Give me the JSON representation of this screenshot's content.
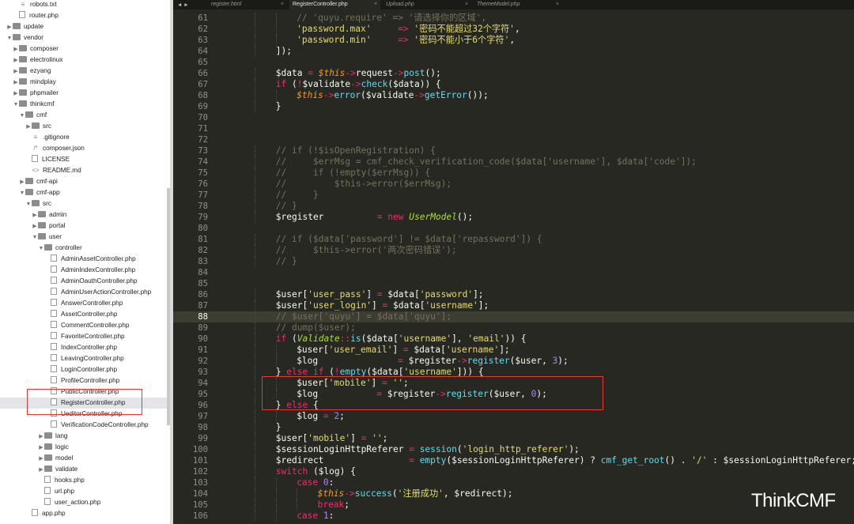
{
  "tabs": [
    {
      "label": "register.html",
      "active": false
    },
    {
      "label": "RegisterController.php",
      "active": true
    },
    {
      "label": "Upload.php",
      "active": false
    },
    {
      "label": "ThemeModel.php",
      "active": false
    }
  ],
  "tree": [
    {
      "label": "robots.txt",
      "depth": 2,
      "type": "txt"
    },
    {
      "label": "router.php",
      "depth": 2,
      "type": "file"
    },
    {
      "label": "update",
      "depth": 0,
      "type": "folder",
      "arrow": "right"
    },
    {
      "label": "vendor",
      "depth": 0,
      "type": "folder",
      "arrow": "down"
    },
    {
      "label": "composer",
      "depth": 1,
      "type": "folder",
      "arrow": "right"
    },
    {
      "label": "electrolinux",
      "depth": 1,
      "type": "folder",
      "arrow": "right"
    },
    {
      "label": "ezyang",
      "depth": 1,
      "type": "folder",
      "arrow": "right"
    },
    {
      "label": "mindplay",
      "depth": 1,
      "type": "folder",
      "arrow": "right"
    },
    {
      "label": "phpmailer",
      "depth": 1,
      "type": "folder",
      "arrow": "right"
    },
    {
      "label": "thinkcmf",
      "depth": 1,
      "type": "folder",
      "arrow": "down"
    },
    {
      "label": "cmf",
      "depth": 2,
      "type": "folder",
      "arrow": "down"
    },
    {
      "label": "src",
      "depth": 3,
      "type": "folder",
      "arrow": "right"
    },
    {
      "label": ".gitignore",
      "depth": 4,
      "type": "txt"
    },
    {
      "label": "composer.json",
      "depth": 4,
      "type": "json"
    },
    {
      "label": "LICENSE",
      "depth": 4,
      "type": "file"
    },
    {
      "label": "README.md",
      "depth": 4,
      "type": "md"
    },
    {
      "label": "cmf-api",
      "depth": 2,
      "type": "folder",
      "arrow": "right"
    },
    {
      "label": "cmf-app",
      "depth": 2,
      "type": "folder",
      "arrow": "down"
    },
    {
      "label": "src",
      "depth": 3,
      "type": "folder",
      "arrow": "down"
    },
    {
      "label": "admin",
      "depth": 4,
      "type": "folder",
      "arrow": "right"
    },
    {
      "label": "portal",
      "depth": 4,
      "type": "folder",
      "arrow": "right"
    },
    {
      "label": "user",
      "depth": 4,
      "type": "folder",
      "arrow": "down"
    },
    {
      "label": "controller",
      "depth": 5,
      "type": "folder",
      "arrow": "down"
    },
    {
      "label": "AdminAssetController.php",
      "depth": 7,
      "type": "file"
    },
    {
      "label": "AdminIndexController.php",
      "depth": 7,
      "type": "file"
    },
    {
      "label": "AdminOauthController.php",
      "depth": 7,
      "type": "file"
    },
    {
      "label": "AdminUserActionController.php",
      "depth": 7,
      "type": "file"
    },
    {
      "label": "AnswerController.php",
      "depth": 7,
      "type": "file"
    },
    {
      "label": "AssetController.php",
      "depth": 7,
      "type": "file"
    },
    {
      "label": "CommentController.php",
      "depth": 7,
      "type": "file"
    },
    {
      "label": "FavoriteController.php",
      "depth": 7,
      "type": "file"
    },
    {
      "label": "IndexController.php",
      "depth": 7,
      "type": "file"
    },
    {
      "label": "LeavingController.php",
      "depth": 7,
      "type": "file"
    },
    {
      "label": "LoginController.php",
      "depth": 7,
      "type": "file"
    },
    {
      "label": "ProfileController.php",
      "depth": 7,
      "type": "file"
    },
    {
      "label": "PublicController.php",
      "depth": 7,
      "type": "file"
    },
    {
      "label": "RegisterController.php",
      "depth": 7,
      "type": "file",
      "selected": true
    },
    {
      "label": "UeditorController.php",
      "depth": 7,
      "type": "file"
    },
    {
      "label": "VerificationCodeController.php",
      "depth": 7,
      "type": "file"
    },
    {
      "label": "lang",
      "depth": 5,
      "type": "folder",
      "arrow": "right"
    },
    {
      "label": "logic",
      "depth": 5,
      "type": "folder",
      "arrow": "right"
    },
    {
      "label": "model",
      "depth": 5,
      "type": "folder",
      "arrow": "right"
    },
    {
      "label": "validate",
      "depth": 5,
      "type": "folder",
      "arrow": "right"
    },
    {
      "label": "hooks.php",
      "depth": 6,
      "type": "file"
    },
    {
      "label": "url.php",
      "depth": 6,
      "type": "file"
    },
    {
      "label": "user_action.php",
      "depth": 6,
      "type": "file"
    },
    {
      "label": "app.php",
      "depth": 4,
      "type": "file"
    }
  ],
  "editor": {
    "first_line": 61,
    "current_line": 88,
    "colors": {
      "bg": "#272822",
      "keyword": "#f92672",
      "string": "#e6db74",
      "func": "#66d9ef",
      "var": "#fd971f",
      "number": "#ae81ff",
      "comment": "#75715e",
      "cls": "#a6e22e",
      "plain": "#f8f8f2"
    },
    "lines": [
      {
        "indent": 12,
        "tokens": [
          [
            "c",
            "// 'quyu.require' => '请选择你的区域',"
          ]
        ]
      },
      {
        "indent": 12,
        "tokens": [
          [
            "s",
            "'password.max'"
          ],
          [
            "p",
            "     "
          ],
          [
            "k",
            "=>"
          ],
          [
            "p",
            " "
          ],
          [
            "s",
            "'密码不能超过32个字符'"
          ],
          [
            "p",
            ","
          ]
        ]
      },
      {
        "indent": 12,
        "tokens": [
          [
            "s",
            "'password.min'"
          ],
          [
            "p",
            "     "
          ],
          [
            "k",
            "=>"
          ],
          [
            "p",
            " "
          ],
          [
            "s",
            "'密码不能小于6个字符'"
          ],
          [
            "p",
            ","
          ]
        ]
      },
      {
        "indent": 8,
        "tokens": [
          [
            "p",
            "]);"
          ]
        ]
      },
      {
        "indent": 0,
        "tokens": []
      },
      {
        "indent": 8,
        "tokens": [
          [
            "p",
            "$data "
          ],
          [
            "k",
            "="
          ],
          [
            "p",
            " "
          ],
          [
            "v",
            "$this"
          ],
          [
            "k",
            "->"
          ],
          [
            "p",
            "request"
          ],
          [
            "k",
            "->"
          ],
          [
            "f",
            "post"
          ],
          [
            "p",
            "();"
          ]
        ]
      },
      {
        "indent": 8,
        "tokens": [
          [
            "k",
            "if"
          ],
          [
            "p",
            " ("
          ],
          [
            "k",
            "!"
          ],
          [
            "p",
            "$validate"
          ],
          [
            "k",
            "->"
          ],
          [
            "f",
            "check"
          ],
          [
            "p",
            "($data)) {"
          ]
        ]
      },
      {
        "indent": 12,
        "tokens": [
          [
            "v",
            "$this"
          ],
          [
            "k",
            "->"
          ],
          [
            "f",
            "error"
          ],
          [
            "p",
            "($validate"
          ],
          [
            "k",
            "->"
          ],
          [
            "f",
            "getError"
          ],
          [
            "p",
            "());"
          ]
        ]
      },
      {
        "indent": 8,
        "tokens": [
          [
            "p",
            "}"
          ]
        ]
      },
      {
        "indent": 0,
        "tokens": []
      },
      {
        "indent": 0,
        "tokens": []
      },
      {
        "indent": 0,
        "tokens": []
      },
      {
        "indent": 8,
        "tokens": [
          [
            "c",
            "// if (!$isOpenRegistration) {"
          ]
        ]
      },
      {
        "indent": 8,
        "tokens": [
          [
            "c",
            "//     $errMsg = cmf_check_verification_code($data['username'], $data['code']);"
          ]
        ]
      },
      {
        "indent": 8,
        "tokens": [
          [
            "c",
            "//     if (!empty($errMsg)) {"
          ]
        ]
      },
      {
        "indent": 8,
        "tokens": [
          [
            "c",
            "//         $this->error($errMsg);"
          ]
        ]
      },
      {
        "indent": 8,
        "tokens": [
          [
            "c",
            "//     }"
          ]
        ]
      },
      {
        "indent": 8,
        "tokens": [
          [
            "c",
            "// }"
          ]
        ]
      },
      {
        "indent": 8,
        "tokens": [
          [
            "p",
            "$register          "
          ],
          [
            "k",
            "="
          ],
          [
            "p",
            " "
          ],
          [
            "k",
            "new"
          ],
          [
            "p",
            " "
          ],
          [
            "n",
            "UserModel"
          ],
          [
            "p",
            "();"
          ]
        ]
      },
      {
        "indent": 0,
        "tokens": []
      },
      {
        "indent": 8,
        "tokens": [
          [
            "c",
            "// if ($data['password'] != $data['repassword']) {"
          ]
        ]
      },
      {
        "indent": 8,
        "tokens": [
          [
            "c",
            "//     $this->error('两次密码错误');"
          ]
        ]
      },
      {
        "indent": 8,
        "tokens": [
          [
            "c",
            "// }"
          ]
        ]
      },
      {
        "indent": 0,
        "tokens": []
      },
      {
        "indent": 0,
        "tokens": []
      },
      {
        "indent": 8,
        "tokens": [
          [
            "p",
            "$user["
          ],
          [
            "s",
            "'user_pass'"
          ],
          [
            "p",
            "] "
          ],
          [
            "k",
            "="
          ],
          [
            "p",
            " $data["
          ],
          [
            "s",
            "'password'"
          ],
          [
            "p",
            "];"
          ]
        ]
      },
      {
        "indent": 8,
        "tokens": [
          [
            "p",
            "$user["
          ],
          [
            "s",
            "'user_login'"
          ],
          [
            "p",
            "] "
          ],
          [
            "k",
            "="
          ],
          [
            "p",
            " $data["
          ],
          [
            "s",
            "'username'"
          ],
          [
            "p",
            "];"
          ]
        ]
      },
      {
        "indent": 8,
        "tokens": [
          [
            "c",
            "// $user['quyu'] = $data['quyu'];"
          ]
        ]
      },
      {
        "indent": 8,
        "tokens": [
          [
            "c",
            "// dump($user);"
          ]
        ]
      },
      {
        "indent": 8,
        "tokens": [
          [
            "k",
            "if"
          ],
          [
            "p",
            " ("
          ],
          [
            "n",
            "Validate"
          ],
          [
            "k",
            "::"
          ],
          [
            "f",
            "is"
          ],
          [
            "p",
            "($data["
          ],
          [
            "s",
            "'username'"
          ],
          [
            "p",
            "], "
          ],
          [
            "s",
            "'email'"
          ],
          [
            "p",
            ")) {"
          ]
        ]
      },
      {
        "indent": 12,
        "tokens": [
          [
            "p",
            "$user["
          ],
          [
            "s",
            "'user_email'"
          ],
          [
            "p",
            "] "
          ],
          [
            "k",
            "="
          ],
          [
            "p",
            " $data["
          ],
          [
            "s",
            "'username'"
          ],
          [
            "p",
            "];"
          ]
        ]
      },
      {
        "indent": 12,
        "tokens": [
          [
            "p",
            "$log               "
          ],
          [
            "k",
            "="
          ],
          [
            "p",
            " $register"
          ],
          [
            "k",
            "->"
          ],
          [
            "f",
            "register"
          ],
          [
            "p",
            "($user, "
          ],
          [
            "m",
            "3"
          ],
          [
            "p",
            ");"
          ]
        ]
      },
      {
        "indent": 8,
        "tokens": [
          [
            "p",
            "} "
          ],
          [
            "k",
            "else if"
          ],
          [
            "p",
            " ("
          ],
          [
            "k",
            "!"
          ],
          [
            "f",
            "empty"
          ],
          [
            "p",
            "($data["
          ],
          [
            "s",
            "'username'"
          ],
          [
            "p",
            "])) {"
          ]
        ]
      },
      {
        "indent": 12,
        "tokens": [
          [
            "p",
            "$user["
          ],
          [
            "s",
            "'mobile'"
          ],
          [
            "p",
            "] "
          ],
          [
            "k",
            "="
          ],
          [
            "p",
            " "
          ],
          [
            "s",
            "''"
          ],
          [
            "p",
            ";"
          ]
        ]
      },
      {
        "indent": 12,
        "tokens": [
          [
            "p",
            "$log           "
          ],
          [
            "k",
            "="
          ],
          [
            "p",
            " $register"
          ],
          [
            "k",
            "->"
          ],
          [
            "f",
            "register"
          ],
          [
            "p",
            "($user, "
          ],
          [
            "m",
            "0"
          ],
          [
            "p",
            ");"
          ]
        ]
      },
      {
        "indent": 8,
        "tokens": [
          [
            "p",
            "} "
          ],
          [
            "k",
            "else"
          ],
          [
            "p",
            " {"
          ]
        ]
      },
      {
        "indent": 12,
        "tokens": [
          [
            "p",
            "$log "
          ],
          [
            "k",
            "="
          ],
          [
            "p",
            " "
          ],
          [
            "m",
            "2"
          ],
          [
            "p",
            ";"
          ]
        ]
      },
      {
        "indent": 8,
        "tokens": [
          [
            "p",
            "}"
          ]
        ]
      },
      {
        "indent": 8,
        "tokens": [
          [
            "p",
            "$user["
          ],
          [
            "s",
            "'mobile'"
          ],
          [
            "p",
            "] "
          ],
          [
            "k",
            "="
          ],
          [
            "p",
            " "
          ],
          [
            "s",
            "''"
          ],
          [
            "p",
            ";"
          ]
        ]
      },
      {
        "indent": 8,
        "tokens": [
          [
            "p",
            "$sessionLoginHttpReferer "
          ],
          [
            "k",
            "="
          ],
          [
            "p",
            " "
          ],
          [
            "f",
            "session"
          ],
          [
            "p",
            "("
          ],
          [
            "s",
            "'login_http_referer'"
          ],
          [
            "p",
            ");"
          ]
        ]
      },
      {
        "indent": 8,
        "tokens": [
          [
            "p",
            "$redirect                "
          ],
          [
            "k",
            "="
          ],
          [
            "p",
            " "
          ],
          [
            "f",
            "empty"
          ],
          [
            "p",
            "($sessionLoginHttpReferer) ? "
          ],
          [
            "f",
            "cmf_get_root"
          ],
          [
            "p",
            "() . "
          ],
          [
            "s",
            "'/'"
          ],
          [
            "p",
            " : $sessionLoginHttpReferer;"
          ]
        ]
      },
      {
        "indent": 8,
        "tokens": [
          [
            "k",
            "switch"
          ],
          [
            "p",
            " ($log) {"
          ]
        ]
      },
      {
        "indent": 12,
        "tokens": [
          [
            "k",
            "case"
          ],
          [
            "p",
            " "
          ],
          [
            "m",
            "0"
          ],
          [
            "p",
            ":"
          ]
        ]
      },
      {
        "indent": 16,
        "tokens": [
          [
            "v",
            "$this"
          ],
          [
            "k",
            "->"
          ],
          [
            "f",
            "success"
          ],
          [
            "p",
            "("
          ],
          [
            "s",
            "'注册成功'"
          ],
          [
            "p",
            ", $redirect);"
          ]
        ]
      },
      {
        "indent": 16,
        "tokens": [
          [
            "k",
            "break"
          ],
          [
            "p",
            ";"
          ]
        ]
      },
      {
        "indent": 12,
        "tokens": [
          [
            "k",
            "case"
          ],
          [
            "p",
            " "
          ],
          [
            "m",
            "1"
          ],
          [
            "p",
            ":"
          ]
        ]
      }
    ]
  },
  "watermark": "ThinkCMF"
}
